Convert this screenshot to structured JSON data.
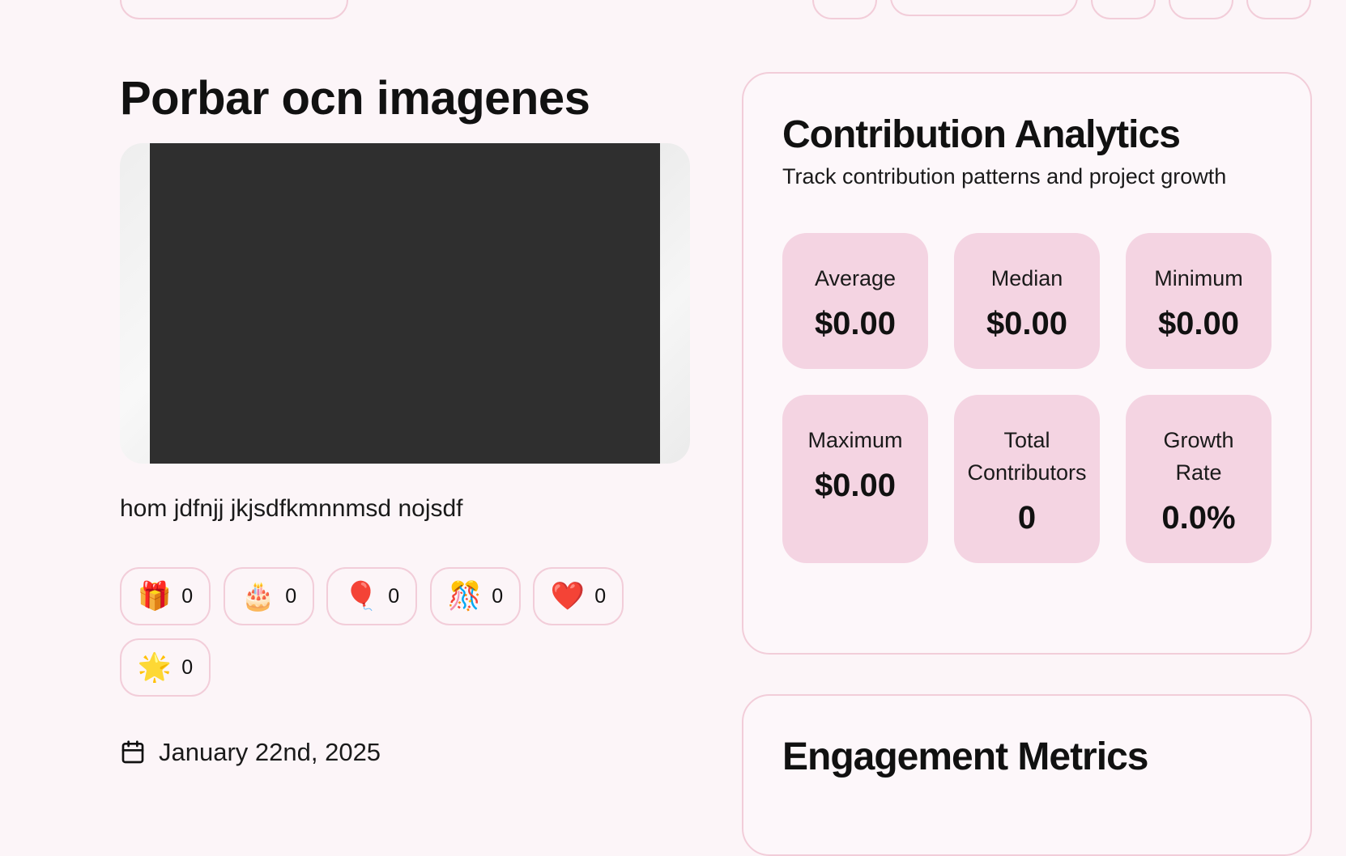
{
  "post": {
    "title": "Porbar ocn imagenes",
    "description": "hom jdfnjj jkjsdfkmnnmsd nojsdf",
    "date": "January 22nd, 2025"
  },
  "reactions": [
    {
      "icon": "gift-icon",
      "emoji": "🎁",
      "count": "0"
    },
    {
      "icon": "cake-icon",
      "emoji": "🎂",
      "count": "0"
    },
    {
      "icon": "balloon-icon",
      "emoji": "🎈",
      "count": "0"
    },
    {
      "icon": "confetti-icon",
      "emoji": "🎊",
      "count": "0"
    },
    {
      "icon": "heart-icon",
      "emoji": "❤️",
      "count": "0"
    },
    {
      "icon": "star-icon",
      "emoji": "🌟",
      "count": "0"
    }
  ],
  "analytics": {
    "title": "Contribution Analytics",
    "subtitle": "Track contribution patterns and project growth",
    "stats": [
      {
        "label": "Average",
        "value": "$0.00"
      },
      {
        "label": "Median",
        "value": "$0.00"
      },
      {
        "label": "Minimum",
        "value": "$0.00"
      },
      {
        "label": "Maximum",
        "value": "$0.00"
      },
      {
        "label": "Total Contributors",
        "value": "0"
      },
      {
        "label": "Growth Rate",
        "value": "0.0%"
      }
    ]
  },
  "engagement": {
    "title": "Engagement Metrics"
  },
  "colors": {
    "background": "#fcf5f8",
    "border": "#f2cdd9",
    "stat_tile": "#f4d4e2"
  }
}
